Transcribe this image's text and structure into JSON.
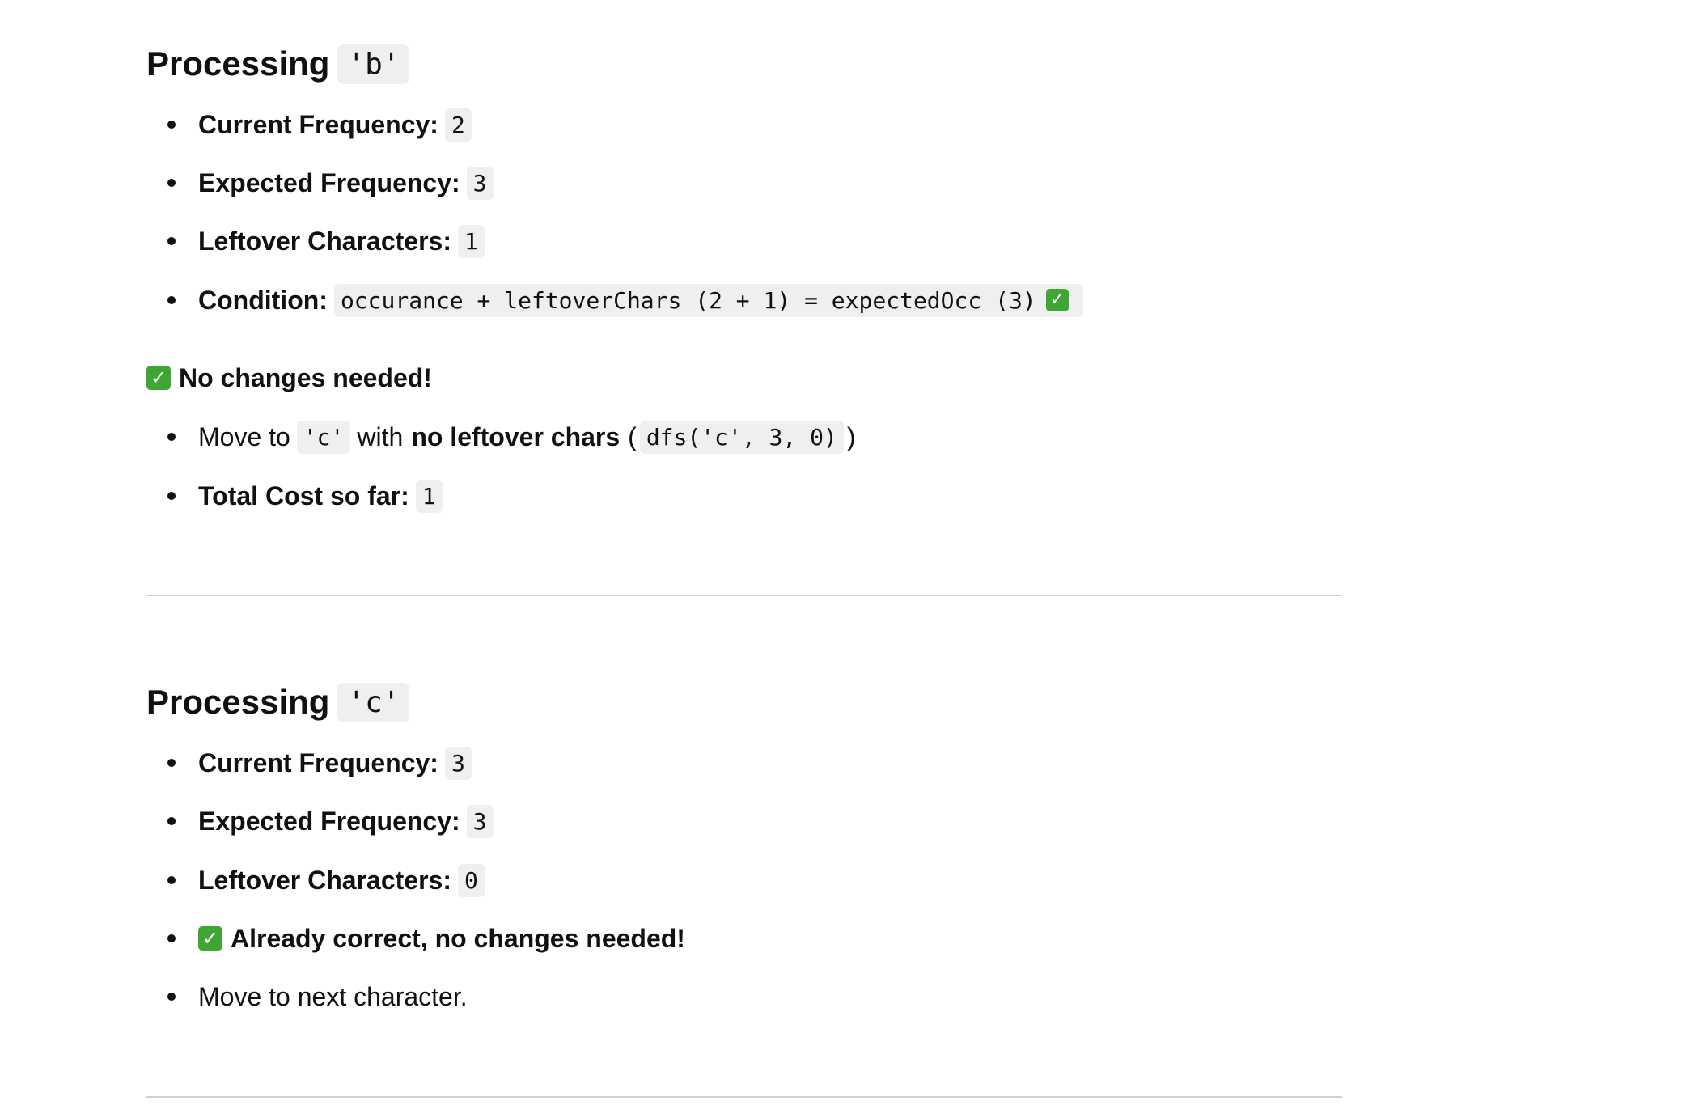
{
  "sections": [
    {
      "heading": "Processing",
      "char": "'b'",
      "current_label": "Current Frequency:",
      "current_value": "2",
      "expected_label": "Expected Frequency:",
      "expected_value": "3",
      "leftover_label": "Leftover Characters:",
      "leftover_value": "1",
      "condition_label": "Condition:",
      "condition_code": "occurance + leftoverChars (2 + 1) = expectedOcc (3)",
      "note": "No changes needed!",
      "move_prefix": "Move to",
      "move_char": "'c'",
      "move_with": "with",
      "move_bold": "no leftover chars",
      "move_open": "(",
      "move_code": "dfs('c', 3, 0)",
      "move_close": ")",
      "cost_label": "Total Cost so far:",
      "cost_value": "1"
    },
    {
      "heading": "Processing",
      "char": "'c'",
      "current_label": "Current Frequency:",
      "current_value": "3",
      "expected_label": "Expected Frequency:",
      "expected_value": "3",
      "leftover_label": "Leftover Characters:",
      "leftover_value": "0",
      "status": "Already correct, no changes needed!",
      "next": "Move to next character."
    }
  ],
  "icons": {
    "check": "check-mark-button-icon",
    "check_color": "#3fa535"
  }
}
